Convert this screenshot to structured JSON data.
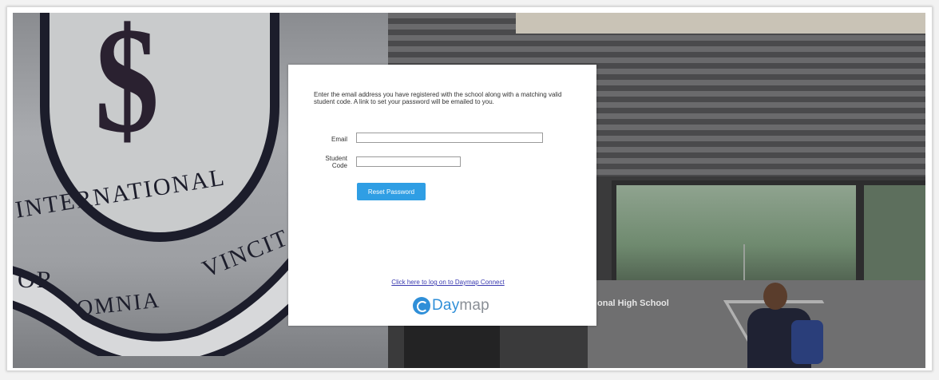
{
  "background": {
    "crest": {
      "word_main": "INTERNATIONAL",
      "motto_left": "OR",
      "motto_middle": "OMNIA",
      "motto_right": "VINCIT"
    },
    "building_sign": "onal High School"
  },
  "form": {
    "instructions": "Enter the email address you have registered with the school along with a matching valid student code. A link to set your password will be emailed to you.",
    "email_label": "Email",
    "email_value": "",
    "student_code_label_line1": "Student",
    "student_code_label_line2": "Code",
    "student_code_value": "",
    "reset_button_label": "Reset Password",
    "connect_link": "Click here to log on to Daymap Connect",
    "logo_text_primary": "Day",
    "logo_text_secondary": "map"
  },
  "colors": {
    "accent": "#2f9ee4",
    "logo_blue": "#2f8fd8",
    "link": "#3a3ab0"
  }
}
